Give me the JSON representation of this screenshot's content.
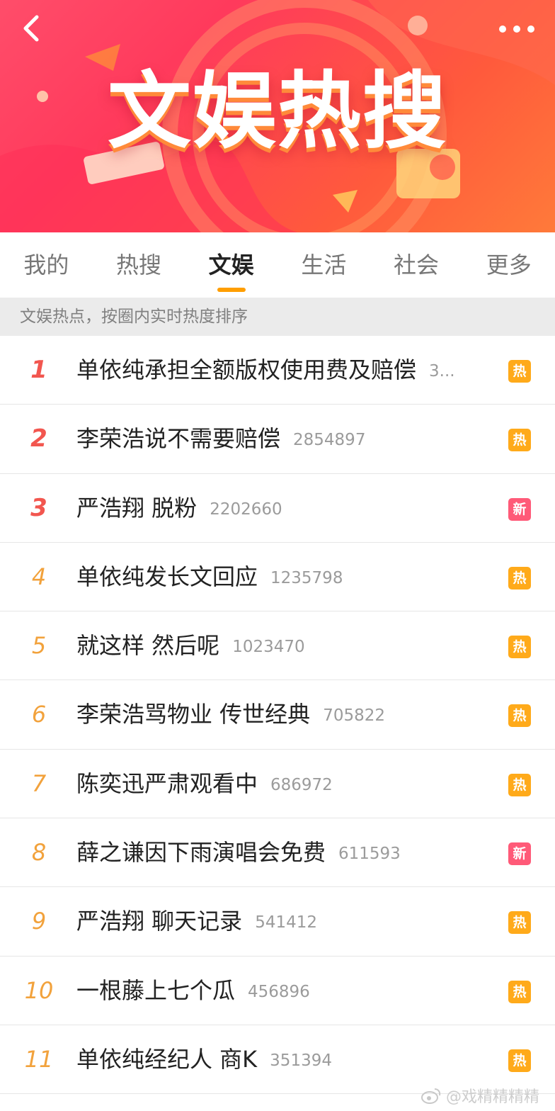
{
  "banner": {
    "title": "文娱热搜",
    "colors": {
      "bg_start": "#ff4d6a",
      "bg_end": "#ff7a3a"
    }
  },
  "nav": {
    "back_icon": "chevron-left-icon",
    "more_icon": "more-dots-icon"
  },
  "tabs": [
    {
      "label": "我的",
      "active": false
    },
    {
      "label": "热搜",
      "active": false
    },
    {
      "label": "文娱",
      "active": true
    },
    {
      "label": "生活",
      "active": false
    },
    {
      "label": "社会",
      "active": false
    },
    {
      "label": "更多",
      "active": false
    }
  ],
  "note": "文娱热点，按圈内实时热度排序",
  "list": [
    {
      "rank": "1",
      "title": "单依纯承担全额版权使用费及赔偿",
      "count": "3...",
      "badge": "热"
    },
    {
      "rank": "2",
      "title": "李荣浩说不需要赔偿",
      "count": "2854897",
      "badge": "热"
    },
    {
      "rank": "3",
      "title": "严浩翔 脱粉",
      "count": "2202660",
      "badge": "新"
    },
    {
      "rank": "4",
      "title": "单依纯发长文回应",
      "count": "1235798",
      "badge": "热"
    },
    {
      "rank": "5",
      "title": "就这样 然后呢",
      "count": "1023470",
      "badge": "热"
    },
    {
      "rank": "6",
      "title": "李荣浩骂物业 传世经典",
      "count": "705822",
      "badge": "热"
    },
    {
      "rank": "7",
      "title": "陈奕迅严肃观看中",
      "count": "686972",
      "badge": "热"
    },
    {
      "rank": "8",
      "title": "薛之谦因下雨演唱会免费",
      "count": "611593",
      "badge": "新"
    },
    {
      "rank": "9",
      "title": "严浩翔 聊天记录",
      "count": "541412",
      "badge": "热"
    },
    {
      "rank": "10",
      "title": "一根藤上七个瓜",
      "count": "456896",
      "badge": "热"
    },
    {
      "rank": "11",
      "title": "单依纯经纪人 商K",
      "count": "351394",
      "badge": "热"
    }
  ],
  "colors": {
    "accent": "#ff9e00",
    "rank_top": "#f2564f",
    "rank_other": "#f2a23c",
    "badge_hot": "#ffaa1a",
    "badge_new": "#ff5a78"
  },
  "watermark": "@戏精精精精"
}
